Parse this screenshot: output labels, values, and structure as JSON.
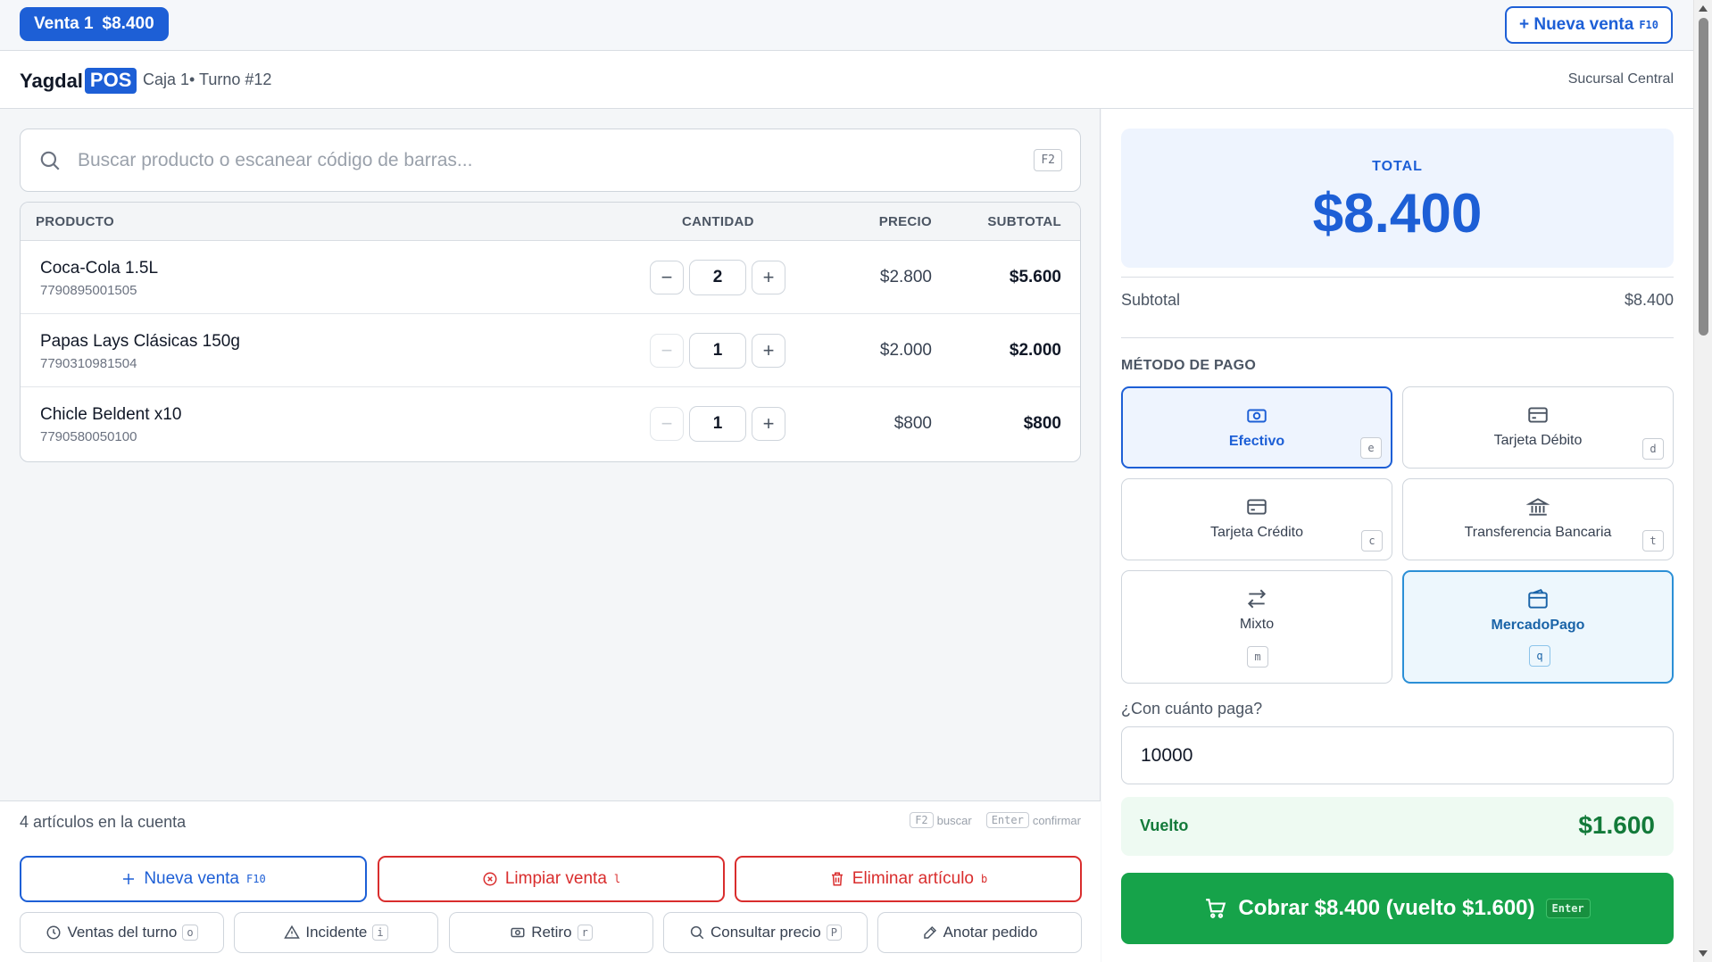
{
  "tabs": [
    {
      "label": "Venta 1",
      "amount": "$8.400"
    }
  ],
  "top_new_sale": {
    "label": "+ Nueva venta",
    "shortcut": "F10"
  },
  "header": {
    "brand_text": "Yagdal",
    "brand_badge": "POS",
    "caja": "Caja 1• Turno #12",
    "sucursal": "Sucursal Central"
  },
  "search": {
    "placeholder": "Buscar producto o escanear código de barras...",
    "shortcut": "F2"
  },
  "table": {
    "headers": {
      "product": "PRODUCTO",
      "quantity": "CANTIDAD",
      "price": "PRECIO",
      "subtotal": "SUBTOTAL"
    },
    "rows": [
      {
        "name": "Coca-Cola 1.5L",
        "code": "7790895001505",
        "qty": "2",
        "price": "$2.800",
        "subtotal": "$5.600"
      },
      {
        "name": "Papas Lays Clásicas 150g",
        "code": "7790310981504",
        "qty": "1",
        "price": "$2.000",
        "subtotal": "$2.000"
      },
      {
        "name": "Chicle Beldent x10",
        "code": "7790580050100",
        "qty": "1",
        "price": "$800",
        "subtotal": "$800"
      }
    ]
  },
  "footer": {
    "count": "4 artículos en la cuenta",
    "hints": [
      {
        "key": "F2",
        "text": "buscar"
      },
      {
        "key": "Enter",
        "text": "confirmar"
      }
    ],
    "actions": [
      {
        "label": "Nueva venta",
        "shortcut": "F10"
      },
      {
        "label": "Limpiar venta",
        "shortcut": "l"
      },
      {
        "label": "Eliminar artículo",
        "shortcut": "b"
      }
    ],
    "secondary": [
      {
        "label": "Ventas del turno",
        "shortcut": "o"
      },
      {
        "label": "Incidente",
        "shortcut": "i"
      },
      {
        "label": "Retiro",
        "shortcut": "r"
      },
      {
        "label": "Consultar precio",
        "shortcut": "P"
      },
      {
        "label": "Anotar pedido",
        "shortcut": ""
      }
    ]
  },
  "summary": {
    "total_label": "TOTAL",
    "total": "$8.400",
    "subtotal_label": "Subtotal",
    "subtotal": "$8.400"
  },
  "payment": {
    "label": "MÉTODO DE PAGO",
    "methods": [
      {
        "label": "Efectivo",
        "key": "e",
        "icon": "cash-icon",
        "state": "selected"
      },
      {
        "label": "Tarjeta Débito",
        "key": "d",
        "icon": "card-icon",
        "state": "normal"
      },
      {
        "label": "Tarjeta Crédito",
        "key": "c",
        "icon": "card-icon",
        "state": "normal"
      },
      {
        "label": "Transferencia Bancaria",
        "key": "t",
        "icon": "bank-icon",
        "state": "normal"
      },
      {
        "label": "Mixto",
        "key": "m",
        "icon": "swap-icon",
        "state": "normal"
      },
      {
        "label": "MercadoPago",
        "key": "q",
        "icon": "wallet-icon",
        "state": "highlighted"
      }
    ],
    "pay_question": "¿Con cuánto paga?",
    "pay_value": "10000",
    "change_label": "Vuelto",
    "change_value": "$1.600",
    "charge_label": "Cobrar $8.400 (vuelto $1.600)",
    "charge_shortcut": "Enter"
  },
  "colors": {
    "accent": "#1d5fd6",
    "danger": "#d92d2d",
    "success": "#16a34a"
  }
}
